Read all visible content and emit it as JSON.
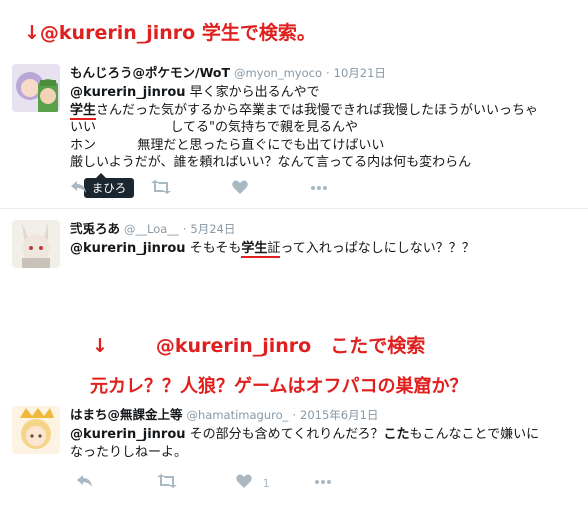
{
  "annotations": {
    "top": "↓@kurerin_jinro 学生で検索。",
    "middle_arrow": "↓",
    "middle": "@kurerin_jinro　こたで検索",
    "bottom": "元カレ？？人狼？ゲームはオフパコの巣窟か？"
  },
  "tweets": [
    {
      "name": "もんじろう@ポケモン/WoT",
      "handle": "@myon_myoco",
      "sep": "·",
      "time": "10月21日",
      "mention": "@kurerin_jinrou",
      "lines": [
        " 早く家から出るんやで",
        "さんだった気がするから卒業までは我慢できれば我慢したほうがいいっちゃ",
        "                  してる\"の気持ちで親を見るんや",
        "ホン          無理だと思ったら直ぐにでも出てけばいい",
        "厳しいようだが、誰を頼ればいい？なんて言ってる内は何も変わらん"
      ],
      "line2_prefix": "学生",
      "line3_prefix": "いい",
      "line4_prefix": "ホン",
      "tooltip": "まひろ",
      "like_count": ""
    },
    {
      "name": "弐兎ろあ",
      "handle": "@__Loa__",
      "sep": "·",
      "time": "5月24日",
      "mention": "@kurerin_jinrou",
      "text_before": " そもそも",
      "highlight": "学生",
      "text_hl_tail": "証",
      "text_after": "って入れっぱなしにしない？？？",
      "like_count": ""
    },
    {
      "name": "はまち@無課金上等",
      "handle": "@hamatimaguro_",
      "sep": "·",
      "time": "2015年6月1日",
      "mention": "@kurerin_jinrou",
      "text_before": " その部分も含めてくれりんだろ？",
      "highlight": "こた",
      "text_after": "もこんなことで嫌いに",
      "line2": "なったりしねーよ。",
      "like_count": "1"
    }
  ],
  "icons": [
    "reply-icon",
    "retweet-icon",
    "like-icon",
    "more-icon"
  ],
  "colors": {
    "accent_red": "#e0201e",
    "muted": "#8899a6",
    "icon": "#aab8c2"
  }
}
